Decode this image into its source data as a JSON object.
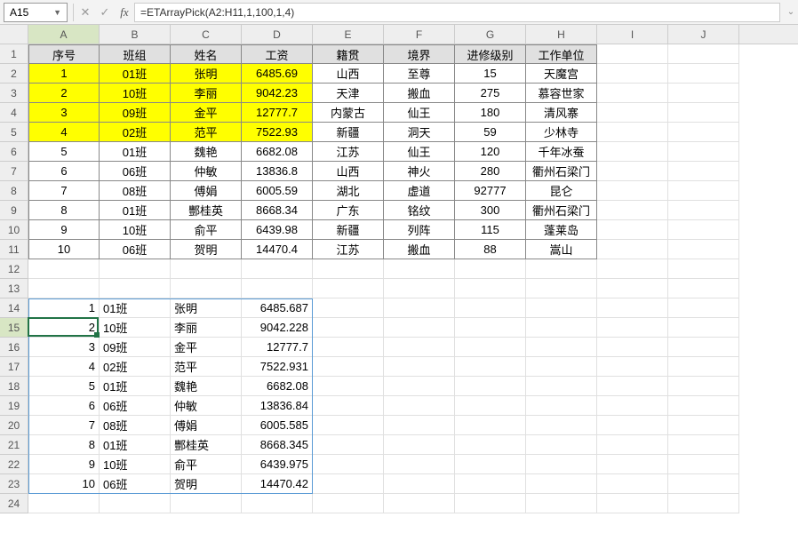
{
  "nameBox": "A15",
  "formula": "=ETArrayPick(A2:H11,1,100,1,4)",
  "cols": [
    "A",
    "B",
    "C",
    "D",
    "E",
    "F",
    "G",
    "H",
    "I",
    "J"
  ],
  "rowCount": 24,
  "header": [
    "序号",
    "班组",
    "姓名",
    "工资",
    "籍贯",
    "境界",
    "进修级别",
    "工作单位"
  ],
  "table": [
    [
      "1",
      "01班",
      "张明",
      "6485.69",
      "山西",
      "至尊",
      "15",
      "天魔宫"
    ],
    [
      "2",
      "10班",
      "李丽",
      "9042.23",
      "天津",
      "搬血",
      "275",
      "慕容世家"
    ],
    [
      "3",
      "09班",
      "金平",
      "12777.7",
      "内蒙古",
      "仙王",
      "180",
      "清风寨"
    ],
    [
      "4",
      "02班",
      "范平",
      "7522.93",
      "新疆",
      "洞天",
      "59",
      "少林寺"
    ],
    [
      "5",
      "01班",
      "魏艳",
      "6682.08",
      "江苏",
      "仙王",
      "120",
      "千年冰蚕"
    ],
    [
      "6",
      "06班",
      "仲敏",
      "13836.8",
      "山西",
      "神火",
      "280",
      "衢州石梁门"
    ],
    [
      "7",
      "08班",
      "傅娟",
      "6005.59",
      "湖北",
      "虚道",
      "92777",
      "昆仑"
    ],
    [
      "8",
      "01班",
      "酆桂英",
      "8668.34",
      "广东",
      "铭纹",
      "300",
      "衢州石梁门"
    ],
    [
      "9",
      "10班",
      "俞平",
      "6439.98",
      "新疆",
      "列阵",
      "115",
      "蓬莱岛"
    ],
    [
      "10",
      "06班",
      "贺明",
      "14470.4",
      "江苏",
      "搬血",
      "88",
      "嵩山"
    ]
  ],
  "spill": [
    [
      "1",
      "01班",
      "张明",
      "6485.687"
    ],
    [
      "2",
      "10班",
      "李丽",
      "9042.228"
    ],
    [
      "3",
      "09班",
      "金平",
      "12777.7"
    ],
    [
      "4",
      "02班",
      "范平",
      "7522.931"
    ],
    [
      "5",
      "01班",
      "魏艳",
      "6682.08"
    ],
    [
      "6",
      "06班",
      "仲敏",
      "13836.84"
    ],
    [
      "7",
      "08班",
      "傅娟",
      "6005.585"
    ],
    [
      "8",
      "01班",
      "酆桂英",
      "8668.345"
    ],
    [
      "9",
      "10班",
      "俞平",
      "6439.975"
    ],
    [
      "10",
      "06班",
      "贺明",
      "14470.42"
    ]
  ],
  "yellowRows": 4,
  "selectedCol": 0,
  "selectedRow": 15,
  "chart_data": {
    "type": "table",
    "title": "",
    "columns": [
      "序号",
      "班组",
      "姓名",
      "工资",
      "籍贯",
      "境界",
      "进修级别",
      "工作单位"
    ],
    "rows": [
      [
        1,
        "01班",
        "张明",
        6485.69,
        "山西",
        "至尊",
        15,
        "天魔宫"
      ],
      [
        2,
        "10班",
        "李丽",
        9042.23,
        "天津",
        "搬血",
        275,
        "慕容世家"
      ],
      [
        3,
        "09班",
        "金平",
        12777.7,
        "内蒙古",
        "仙王",
        180,
        "清风寨"
      ],
      [
        4,
        "02班",
        "范平",
        7522.93,
        "新疆",
        "洞天",
        59,
        "少林寺"
      ],
      [
        5,
        "01班",
        "魏艳",
        6682.08,
        "江苏",
        "仙王",
        120,
        "千年冰蚕"
      ],
      [
        6,
        "06班",
        "仲敏",
        13836.8,
        "山西",
        "神火",
        280,
        "衢州石梁门"
      ],
      [
        7,
        "08班",
        "傅娟",
        6005.59,
        "湖北",
        "虚道",
        92777,
        "昆仑"
      ],
      [
        8,
        "01班",
        "酆桂英",
        8668.34,
        "广东",
        "铭纹",
        300,
        "衢州石梁门"
      ],
      [
        9,
        "10班",
        "俞平",
        6439.98,
        "新疆",
        "列阵",
        115,
        "蓬莱岛"
      ],
      [
        10,
        "06班",
        "贺明",
        14470.4,
        "江苏",
        "搬血",
        88,
        "嵩山"
      ]
    ]
  }
}
